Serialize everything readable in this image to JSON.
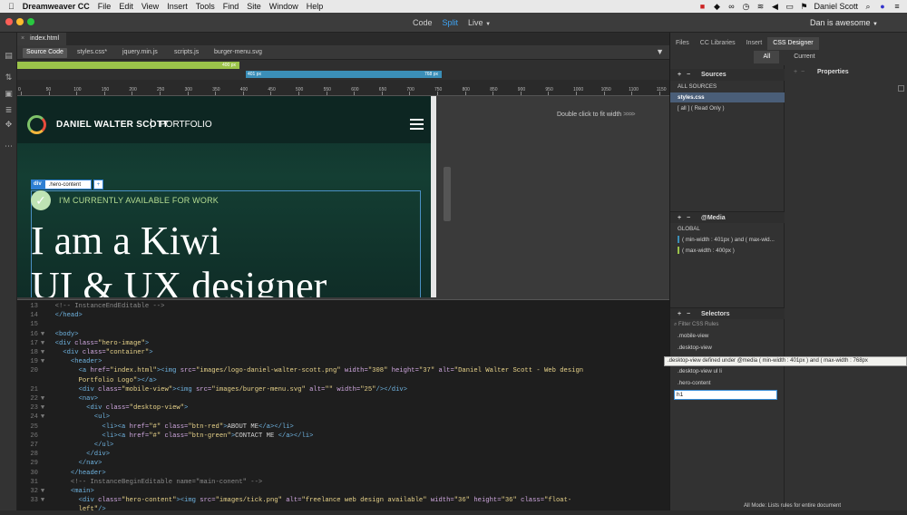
{
  "menubar": {
    "app_name": "Dreamweaver CC",
    "items": [
      "File",
      "Edit",
      "View",
      "Insert",
      "Tools",
      "Find",
      "Site",
      "Window",
      "Help"
    ],
    "user": "Daniel Scott"
  },
  "titlebar": {
    "view_modes": [
      "Code",
      "Split",
      "Live"
    ],
    "active_mode": "Split",
    "workspace_user": "Dan is awesome"
  },
  "document": {
    "tab_label": "index.html",
    "related_files": [
      "Source Code",
      "styles.css*",
      "jquery.min.js",
      "scripts.js",
      "burger-menu.svg"
    ]
  },
  "media_bars": {
    "green_label": "400 px",
    "blue_left": "401 px",
    "blue_right": "768 px"
  },
  "ruler": {
    "ticks": [
      "0",
      "50",
      "100",
      "150",
      "200",
      "250",
      "300",
      "350",
      "400",
      "450",
      "500",
      "550",
      "600",
      "650",
      "700",
      "750",
      "800",
      "850",
      "900",
      "950",
      "1000",
      "1050",
      "1100",
      "1150"
    ]
  },
  "design": {
    "site_name": "DANIEL WALTER SCOTT",
    "site_separator": "|",
    "site_portfolio": "PORTFOLIO",
    "selector_tag": "div",
    "selector_class": ".hero-content",
    "selector_plus": "+",
    "available_text": "I'M CURRENTLY AVAILABLE FOR WORK",
    "hero_line1": "I am a Kiwi",
    "hero_line2": "UI & UX designer",
    "fit_width_hint": "Double click to fit width"
  },
  "code": {
    "lines": [
      {
        "n": "13",
        "f": "",
        "html": "  <span class=\"cm\">&lt;!-- InstanceEndEditable --&gt;</span>"
      },
      {
        "n": "14",
        "f": "",
        "html": "  <span class=\"tg\">&lt;/head&gt;</span>"
      },
      {
        "n": "15",
        "f": "",
        "html": ""
      },
      {
        "n": "16",
        "f": "▼",
        "html": "  <span class=\"tg\">&lt;body&gt;</span>"
      },
      {
        "n": "17",
        "f": "▼",
        "html": "  <span class=\"tg\">&lt;div</span> <span class=\"at\">class=</span><span class=\"st\">\"hero-image\"</span><span class=\"tg\">&gt;</span>"
      },
      {
        "n": "18",
        "f": "▼",
        "html": "    <span class=\"tg\">&lt;div</span> <span class=\"at\">class=</span><span class=\"st\">\"container\"</span><span class=\"tg\">&gt;</span>"
      },
      {
        "n": "19",
        "f": "▼",
        "html": "      <span class=\"tg\">&lt;header&gt;</span>"
      },
      {
        "n": "20",
        "f": "",
        "html": "        <span class=\"tg\">&lt;a</span> <span class=\"at\">href=</span><span class=\"st\">\"index.html\"</span><span class=\"tg\">&gt;&lt;img</span> <span class=\"at\">src=</span><span class=\"st\">\"images/logo-daniel-walter-scott.png\"</span> <span class=\"at\">width=</span><span class=\"st\">\"308\"</span> <span class=\"at\">height=</span><span class=\"st\">\"37\"</span> <span class=\"at\">alt=</span><span class=\"st\">\"Daniel Walter Scott - Web design</span>"
      },
      {
        "n": "",
        "f": "",
        "html": "        <span class=\"st\">Portfolio Logo\"</span><span class=\"tg\">&gt;&lt;/a&gt;</span>"
      },
      {
        "n": "21",
        "f": "",
        "html": "        <span class=\"tg\">&lt;div</span> <span class=\"at\">class=</span><span class=\"st\">\"mobile-view\"</span><span class=\"tg\">&gt;&lt;img</span> <span class=\"at\">src=</span><span class=\"st\">\"images/burger-menu.svg\"</span> <span class=\"at\">alt=</span><span class=\"st\">\"\"</span> <span class=\"at\">width=</span><span class=\"st\">\"25\"</span><span class=\"tg\">/&gt;&lt;/div&gt;</span>"
      },
      {
        "n": "22",
        "f": "▼",
        "html": "        <span class=\"tg\">&lt;nav&gt;</span>"
      },
      {
        "n": "23",
        "f": "▼",
        "html": "          <span class=\"tg\">&lt;div</span> <span class=\"at\">class=</span><span class=\"st\">\"desktop-view\"</span><span class=\"tg\">&gt;</span>"
      },
      {
        "n": "24",
        "f": "▼",
        "html": "            <span class=\"tg\">&lt;ul&gt;</span>"
      },
      {
        "n": "25",
        "f": "",
        "html": "              <span class=\"tg\">&lt;li&gt;&lt;a</span> <span class=\"at\">href=</span><span class=\"st\">\"#\"</span> <span class=\"at\">class=</span><span class=\"st\">\"btn-red\"</span><span class=\"tg\">&gt;</span>ABOUT ME<span class=\"tg\">&lt;/a&gt;&lt;/li&gt;</span>"
      },
      {
        "n": "26",
        "f": "",
        "html": "              <span class=\"tg\">&lt;li&gt;&lt;a</span> <span class=\"at\">href=</span><span class=\"st\">\"#\"</span> <span class=\"at\">class=</span><span class=\"st\">\"btn-green\"</span><span class=\"tg\">&gt;</span>CONTACT ME <span class=\"tg\">&lt;/a&gt;&lt;/li&gt;</span>"
      },
      {
        "n": "27",
        "f": "",
        "html": "            <span class=\"tg\">&lt;/ul&gt;</span>"
      },
      {
        "n": "28",
        "f": "",
        "html": "          <span class=\"tg\">&lt;/div&gt;</span>"
      },
      {
        "n": "29",
        "f": "",
        "html": "        <span class=\"tg\">&lt;/nav&gt;</span>"
      },
      {
        "n": "30",
        "f": "",
        "html": "      <span class=\"tg\">&lt;/header&gt;</span>"
      },
      {
        "n": "31",
        "f": "",
        "html": "      <span class=\"cm\">&lt;!-- InstanceBeginEditable name=\"main-conent\" --&gt;</span>"
      },
      {
        "n": "32",
        "f": "▼",
        "html": "      <span class=\"tg\">&lt;main&gt;</span>"
      },
      {
        "n": "33",
        "f": "▼",
        "html": "        <span class=\"tg\">&lt;div</span> <span class=\"at\">class=</span><span class=\"st\">\"hero-content\"</span><span class=\"tg\">&gt;&lt;img</span> <span class=\"at\">src=</span><span class=\"st\">\"images/tick.png\"</span> <span class=\"at\">alt=</span><span class=\"st\">\"freelance web design available\"</span> <span class=\"at\">width=</span><span class=\"st\">\"36\"</span> <span class=\"at\">height=</span><span class=\"st\">\"36\"</span> <span class=\"at\">class=</span><span class=\"st\">\"float-</span>"
      },
      {
        "n": "",
        "f": "",
        "html": "        <span class=\"st\">left\"</span><span class=\"tg\">/&gt;</span>"
      }
    ]
  },
  "panels": {
    "tabs": [
      "Files",
      "CC Libraries",
      "Insert",
      "CSS Designer"
    ],
    "active_tab": "CSS Designer",
    "all_label": "All",
    "current_label": "Current",
    "sources_title": "Sources",
    "sources": [
      "ALL SOURCES",
      "styles.css",
      "[ all ] ( Read Only )"
    ],
    "properties_title": "Properties",
    "media_title": "@Media",
    "media": [
      "GLOBAL",
      "( min-width : 401px ) and ( max-wid...",
      "( max-width : 400px )"
    ],
    "selectors_title": "Selectors",
    "filter_placeholder": "Filter CSS Rules",
    "selectors": [
      ".mobile-view",
      ".desktop-view",
      ".desktop-view ul li",
      ".hero-content"
    ],
    "new_selector_value": "h1",
    "tooltip": ".desktop-view defined under @media ( min-width : 401px ) and ( max-width : 768px",
    "status": "All Mode: Lists rules for entire document",
    "plus": "+",
    "minus": "−"
  },
  "colors": {
    "green_bar": "#9bc34a",
    "blue_bar": "#3b8fb8",
    "accent": "#3ea3f2"
  }
}
